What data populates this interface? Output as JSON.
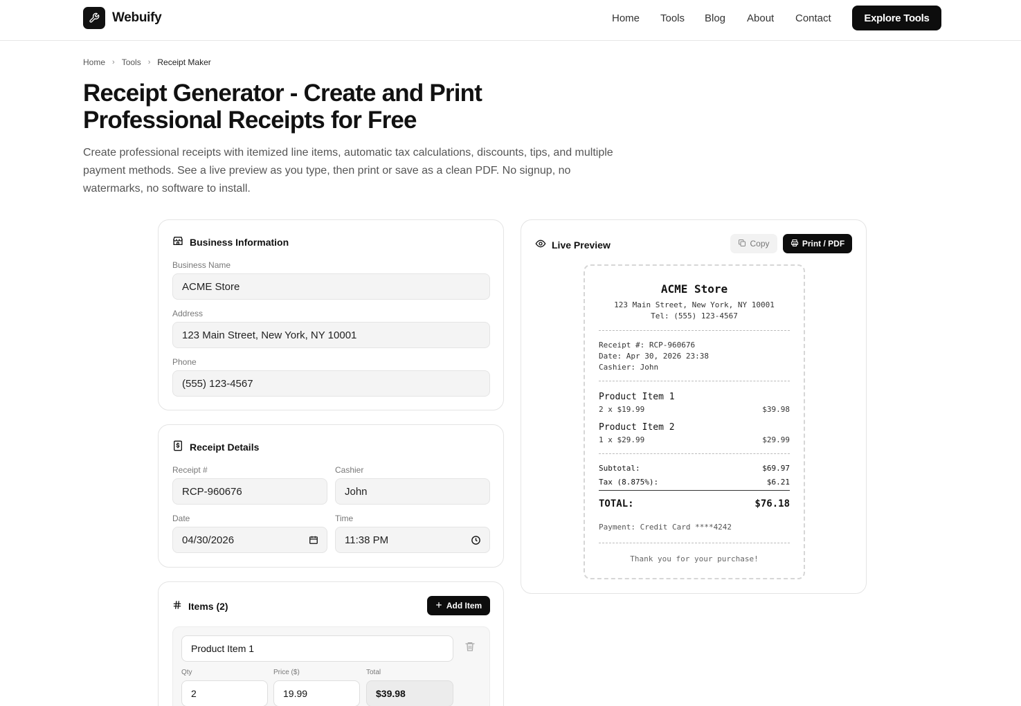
{
  "brand": {
    "name": "Webuify",
    "logo_icon": "wrench-icon"
  },
  "nav": {
    "home": "Home",
    "tools": "Tools",
    "blog": "Blog",
    "about": "About",
    "contact": "Contact",
    "cta": "Explore Tools"
  },
  "breadcrumb": {
    "home": "Home",
    "tools": "Tools",
    "current": "Receipt Maker"
  },
  "hero": {
    "title_line1": "Receipt Generator - Create and Print",
    "title_line2": "Professional Receipts for Free",
    "description": "Create professional receipts with itemized line items, automatic tax calculations, discounts, tips, and multiple payment methods. See a live preview as you type, then print or save as a clean PDF. No signup, no watermarks, no software to install."
  },
  "business": {
    "heading": "Business Information",
    "name_label": "Business Name",
    "name_value": "ACME Store",
    "address_label": "Address",
    "address_value": "123 Main Street, New York, NY 10001",
    "phone_label": "Phone",
    "phone_value": "(555) 123-4567"
  },
  "details": {
    "heading": "Receipt Details",
    "receipt_label": "Receipt #",
    "receipt_value": "RCP-960676",
    "cashier_label": "Cashier",
    "cashier_value": "John",
    "date_label": "Date",
    "date_value": "04/30/2026",
    "time_label": "Time",
    "time_value": "11:38 PM"
  },
  "items_section": {
    "heading": "Items (2)",
    "add_label": "Add Item",
    "first_item": {
      "name": "Product Item 1",
      "qty_label": "Qty",
      "qty": "2",
      "price_label": "Price ($)",
      "price": "19.99",
      "total_label": "Total",
      "total": "$39.98"
    }
  },
  "preview": {
    "heading": "Live Preview",
    "copy_label": "Copy",
    "print_label": "Print / PDF",
    "receipt": {
      "store": "ACME Store",
      "address": "123 Main Street, New York, NY 10001",
      "tel": "Tel: (555) 123-4567",
      "receipt_no": "Receipt #: RCP-960676",
      "date": "Date: Apr 30, 2026 23:38",
      "cashier": "Cashier: John",
      "items": [
        {
          "name": "Product Item 1",
          "qty_price": "2 x $19.99",
          "amount": "$39.98"
        },
        {
          "name": "Product Item 2",
          "qty_price": "1 x $29.99",
          "amount": "$29.99"
        }
      ],
      "subtotal_label": "Subtotal:",
      "subtotal": "$69.97",
      "tax_label": "Tax (8.875%):",
      "tax": "$6.21",
      "total_label": "TOTAL:",
      "total": "$76.18",
      "payment": "Payment: Credit Card ****4242",
      "thanks": "Thank you for your purchase!"
    }
  }
}
